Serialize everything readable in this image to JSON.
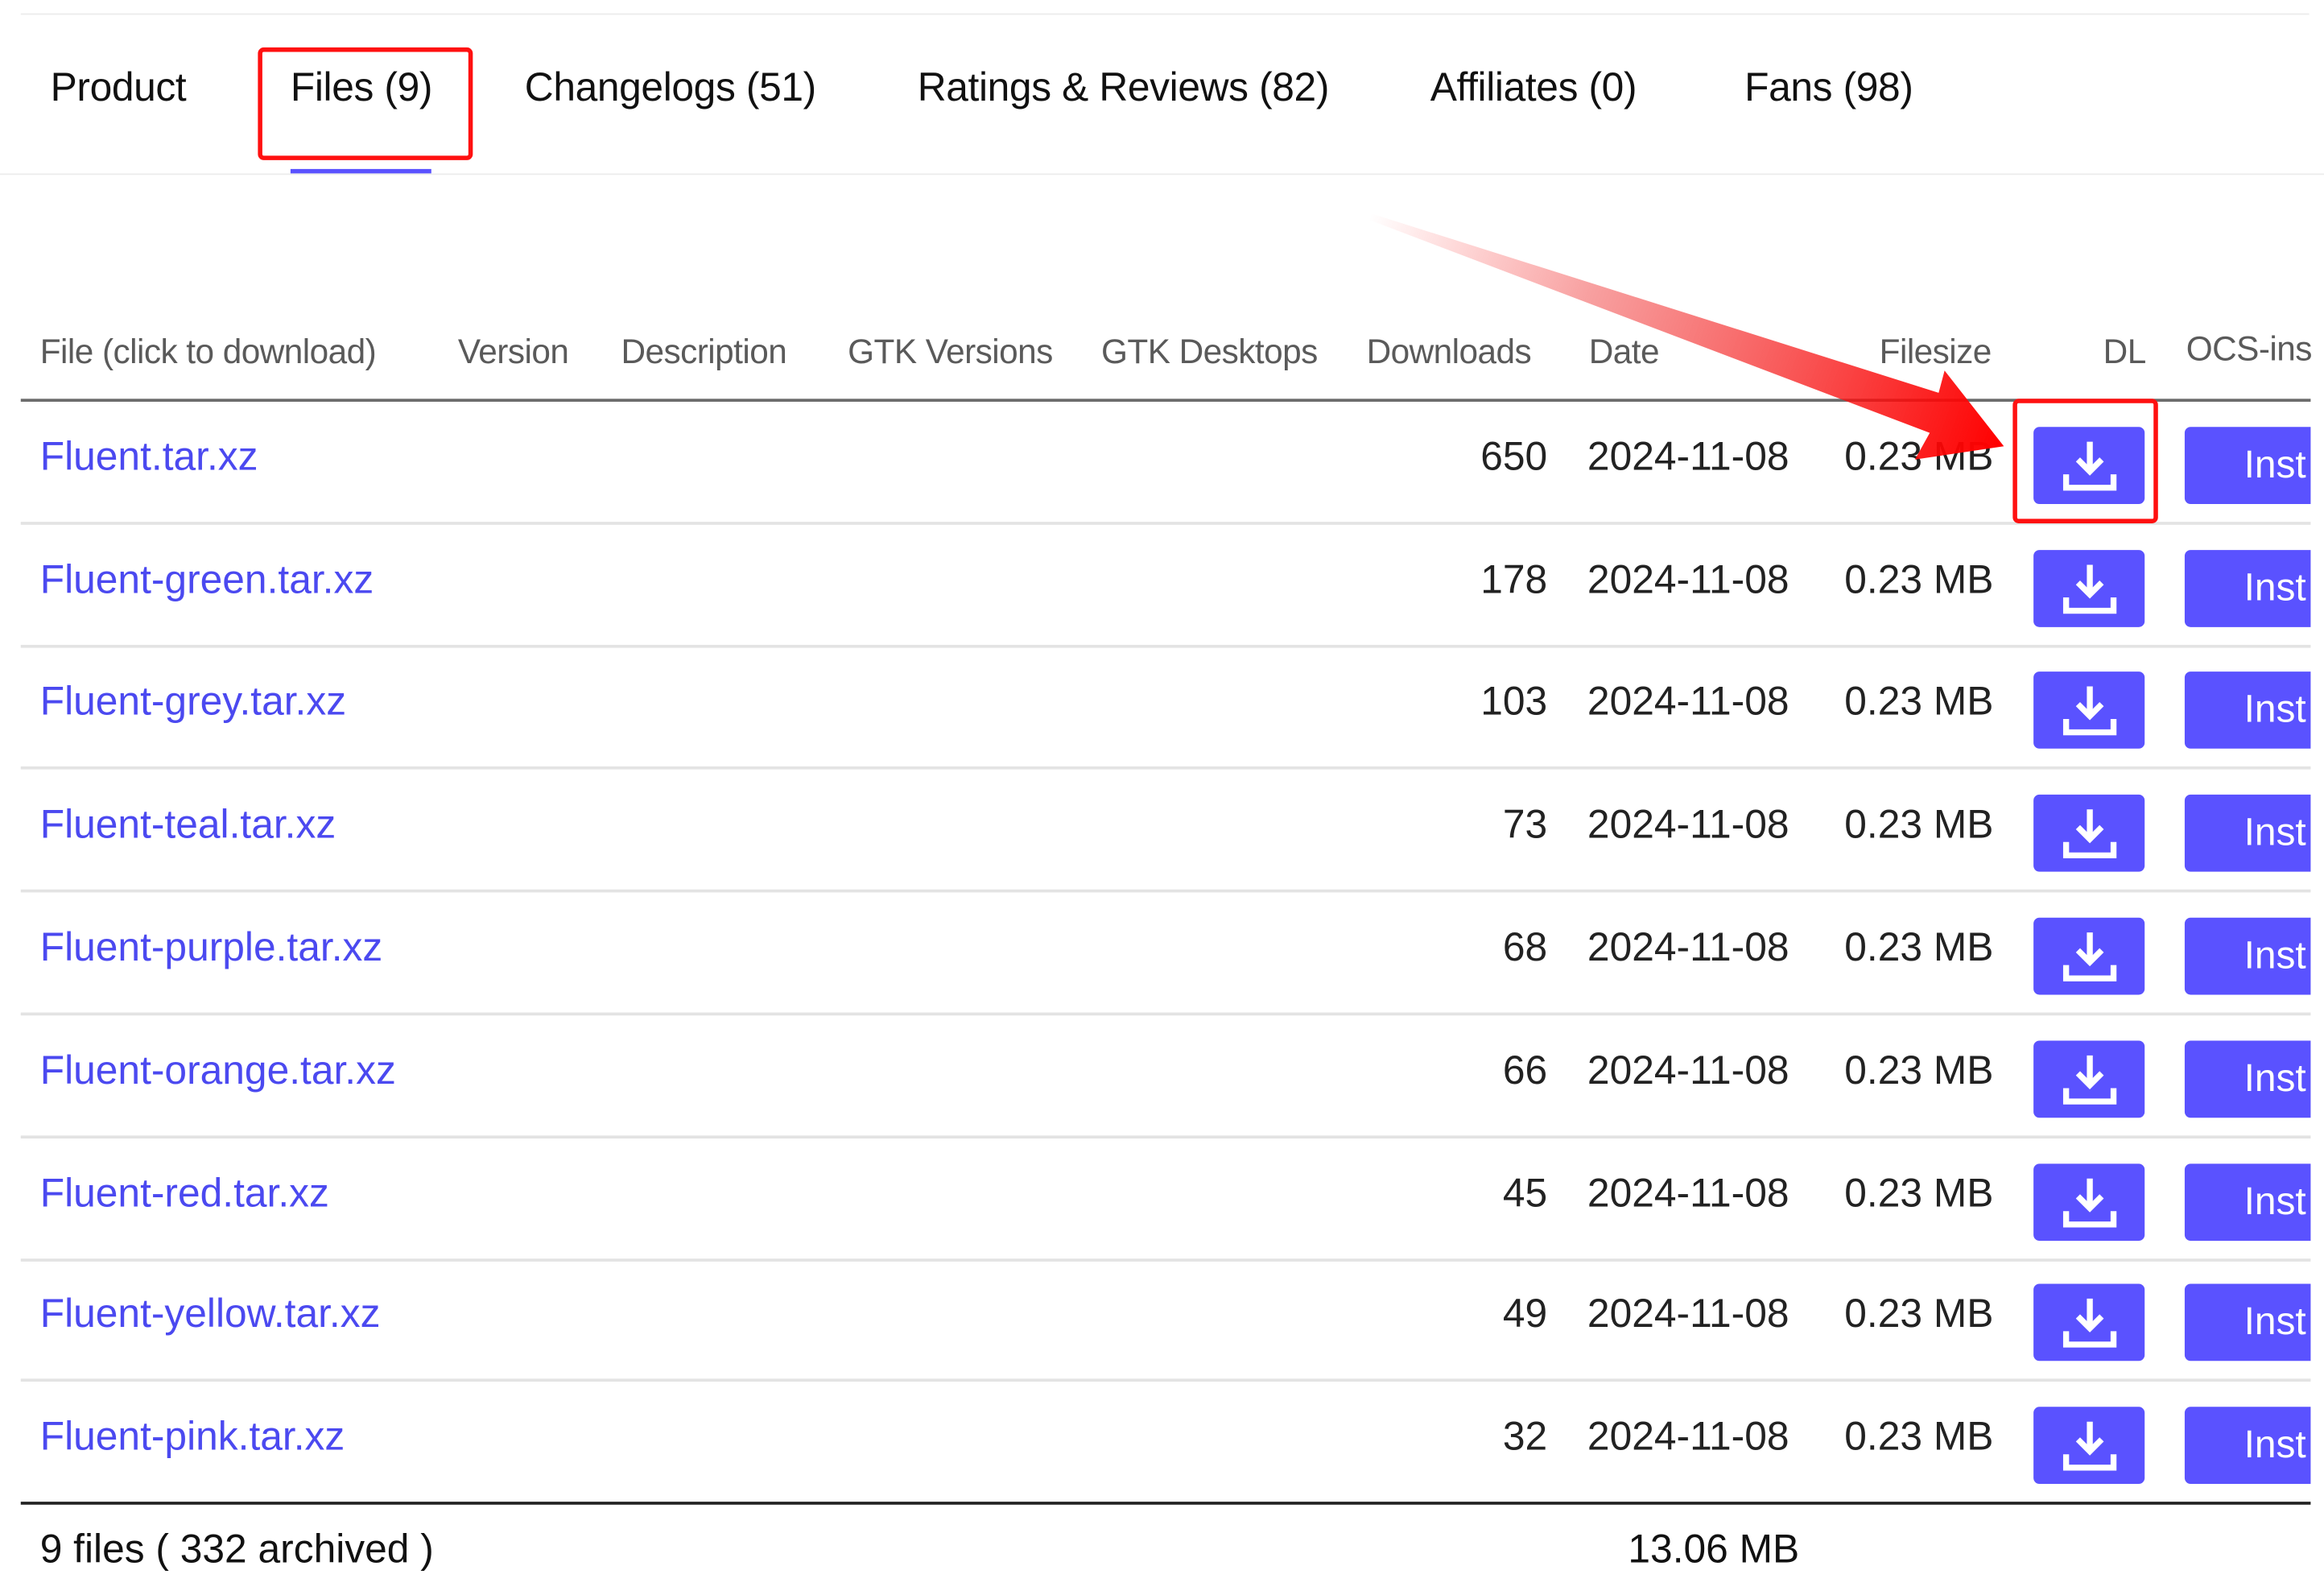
{
  "tabs": [
    {
      "label": "Product"
    },
    {
      "label": "Files (9)",
      "active": true
    },
    {
      "label": "Changelogs (51)"
    },
    {
      "label": "Ratings & Reviews (82)"
    },
    {
      "label": "Affiliates (0)"
    },
    {
      "label": "Fans (98)"
    }
  ],
  "table": {
    "headers": {
      "file": "File (click to download)",
      "version": "Version",
      "description": "Description",
      "gtk_versions": "GTK Versions",
      "gtk_desktops": "GTK Desktops",
      "downloads": "Downloads",
      "date": "Date",
      "filesize": "Filesize",
      "dl": "DL",
      "ocs": "OCS-ins"
    },
    "install_label": "Inst",
    "rows": [
      {
        "file": "Fluent.tar.xz",
        "downloads": "650",
        "date": "2024-11-08",
        "size": "0.23 MB"
      },
      {
        "file": "Fluent-green.tar.xz",
        "downloads": "178",
        "date": "2024-11-08",
        "size": "0.23 MB"
      },
      {
        "file": "Fluent-grey.tar.xz",
        "downloads": "103",
        "date": "2024-11-08",
        "size": "0.23 MB"
      },
      {
        "file": "Fluent-teal.tar.xz",
        "downloads": "73",
        "date": "2024-11-08",
        "size": "0.23 MB"
      },
      {
        "file": "Fluent-purple.tar.xz",
        "downloads": "68",
        "date": "2024-11-08",
        "size": "0.23 MB"
      },
      {
        "file": "Fluent-orange.tar.xz",
        "downloads": "66",
        "date": "2024-11-08",
        "size": "0.23 MB"
      },
      {
        "file": "Fluent-red.tar.xz",
        "downloads": "45",
        "date": "2024-11-08",
        "size": "0.23 MB"
      },
      {
        "file": "Fluent-yellow.tar.xz",
        "downloads": "49",
        "date": "2024-11-08",
        "size": "0.23 MB"
      },
      {
        "file": "Fluent-pink.tar.xz",
        "downloads": "32",
        "date": "2024-11-08",
        "size": "0.23 MB"
      }
    ]
  },
  "footer": {
    "summary": "9 files ( 332 archived )",
    "total_size": "13.06 MB"
  },
  "icons": {
    "download": "download-icon",
    "annotation": "red-arrow"
  },
  "colors": {
    "accent": "#5a52ff",
    "link": "#4b49f0",
    "highlight": "#ff1010"
  }
}
